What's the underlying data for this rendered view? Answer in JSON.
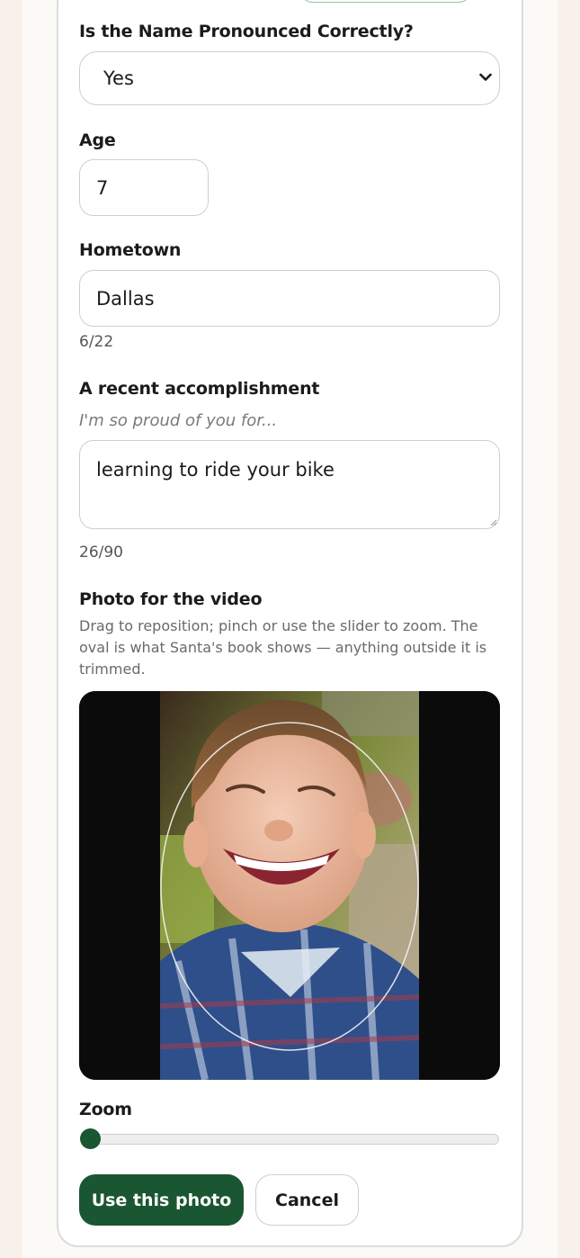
{
  "form": {
    "pronounced_label": "Is the Name Pronounced Correctly?",
    "pronounced_value": "Yes",
    "age_label": "Age",
    "age_value": "7",
    "hometown_label": "Hometown",
    "hometown_value": "Dallas",
    "hometown_counter": "6/22",
    "accomplishment_label": "A recent accomplishment",
    "accomplishment_hint": "I'm so proud of you for...",
    "accomplishment_value": "learning to ride your bike",
    "accomplishment_counter": "26/90"
  },
  "photo": {
    "label": "Photo for the video",
    "description": "Drag to reposition; pinch or use the slider to zoom. The oval is what Santa's book shows — anything outside it is trimmed."
  },
  "zoom": {
    "label": "Zoom",
    "level": 0
  },
  "actions": {
    "use_label": "Use this photo",
    "cancel_label": "Cancel"
  },
  "colors": {
    "primary": "#1b5632",
    "background": "#f7f1ea"
  }
}
